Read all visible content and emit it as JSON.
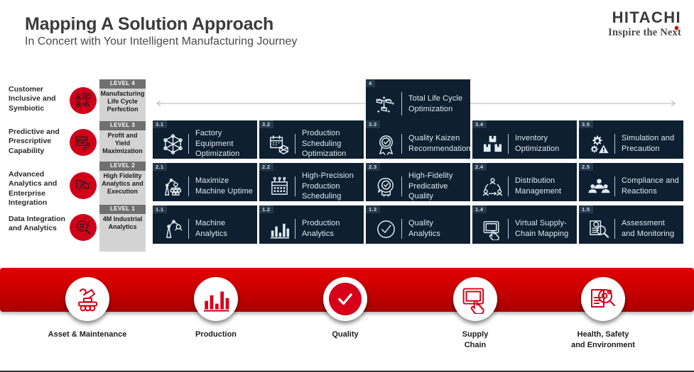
{
  "header": {
    "title": "Mapping A Solution Approach",
    "subtitle": "In Concert with Your Intelligent Manufacturing Journey",
    "logo_main": "HITACHI",
    "logo_tagline": "Inspire the Next"
  },
  "capabilities": [
    {
      "label": "Customer Inclusive and Symbiotic",
      "icon": "people-collaboration-icon"
    },
    {
      "label": "Predictive and Prescriptive Capability",
      "icon": "schedule-chart-pen-icon"
    },
    {
      "label": "Advanced Analytics and Enterprise Integration",
      "icon": "puzzle-integration-icon"
    },
    {
      "label": "Data Integration and Analytics",
      "icon": "magnifier-data-icon"
    }
  ],
  "levels": [
    {
      "badge": "LEVEL 4",
      "name": "Manufacturing Life Cycle Perfection"
    },
    {
      "badge": "LEVEL 3",
      "name": "Profit and Yield Maximization"
    },
    {
      "badge": "LEVEL 2",
      "name": "High Fidelity Analytics and Execution"
    },
    {
      "badge": "LEVEL 1",
      "name": "4M Industrial Analytics"
    }
  ],
  "top_card": {
    "number": "4",
    "title": "Total Life Cycle Optimization",
    "icon": "connected-factories-icon"
  },
  "grid_rows": [
    {
      "row": "3",
      "cards": [
        {
          "number": "3.1",
          "title": "Factory Equipment Optimization",
          "icon": "network-hex-icon"
        },
        {
          "number": "3.2",
          "title": "Production Scheduling Optimization",
          "icon": "calendar-network-icon"
        },
        {
          "number": "3.3",
          "title": "Quality Kaizen Recommendation",
          "icon": "award-check-icon"
        },
        {
          "number": "3.4",
          "title": "Inventory Optimization",
          "icon": "boxes-inventory-icon"
        },
        {
          "number": "3.5",
          "title": "Simulation and Precaution",
          "icon": "gears-warning-icon"
        }
      ]
    },
    {
      "row": "2",
      "cards": [
        {
          "number": "2.1",
          "title": "Maximize Machine Uptime",
          "icon": "robot-arm-network-icon"
        },
        {
          "number": "2.2",
          "title": "High-Precision Production Scheduling",
          "icon": "calendar-grid-icon"
        },
        {
          "number": "2.3",
          "title": "High-Fidelity Predicative Quality",
          "icon": "quality-seal-icon"
        },
        {
          "number": "2.4",
          "title": "Distribution Management",
          "icon": "distribution-nodes-icon"
        },
        {
          "number": "2.5",
          "title": "Compliance and Reactions",
          "icon": "people-group-icon"
        }
      ]
    },
    {
      "row": "1",
      "cards": [
        {
          "number": "1.1",
          "title": "Machine Analytics",
          "icon": "robot-arm-icon"
        },
        {
          "number": "1.2",
          "title": "Production Analytics",
          "icon": "bar-chart-icon"
        },
        {
          "number": "1.3",
          "title": "Quality Analytics",
          "icon": "check-circle-icon"
        },
        {
          "number": "1.4",
          "title": "Virtual Supply-Chain Mapping",
          "icon": "tablet-touch-icon"
        },
        {
          "number": "1.5",
          "title": "Assessment and Monitoring",
          "icon": "document-magnifier-icon"
        }
      ]
    }
  ],
  "bottom_items": [
    {
      "label": "Asset & Maintenance",
      "icon": "robot-arm-vehicle-icon",
      "style": "outline"
    },
    {
      "label": "Production",
      "icon": "bar-chart-icon",
      "style": "outline"
    },
    {
      "label": "Quality",
      "icon": "check-icon",
      "style": "filled"
    },
    {
      "label": "Supply\nChain",
      "icon": "tablet-touch-icon",
      "style": "outline"
    },
    {
      "label": "Health, Safety\nand Environment",
      "icon": "document-magnifier-gear-icon",
      "style": "outline"
    }
  ],
  "colors": {
    "brand_red": "#d10019",
    "card_navy": "#0d1f30",
    "badge_navy": "#24384b",
    "level_grey": "#d3d3d3",
    "level_badge_grey": "#707070"
  }
}
